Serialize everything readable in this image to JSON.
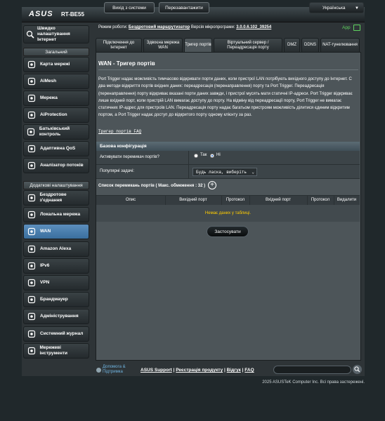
{
  "header": {
    "brand": "ASUS",
    "model": "RT-BE55",
    "logout": "Вихід з системи",
    "reboot": "Перезавантажити",
    "language": "Українська"
  },
  "sidebar": {
    "quick_setup": "Швидко налаштування Інтернет",
    "general_header": "Загальний",
    "general": [
      {
        "label": "Карта мережі",
        "icon": "network-map-icon"
      },
      {
        "label": "AiMesh",
        "icon": "aimesh-icon"
      },
      {
        "label": "Мережа",
        "icon": "network-icon"
      },
      {
        "label": "AiProtection",
        "icon": "shield-icon"
      },
      {
        "label": "Батьківський контроль",
        "icon": "parental-icon"
      },
      {
        "label": "Адаптивна QoS",
        "icon": "qos-gauge-icon"
      },
      {
        "label": "Аналізатор потоків",
        "icon": "traffic-analyzer-icon"
      }
    ],
    "advanced_header": "Додаткові налаштування",
    "advanced": [
      {
        "label": "Бездротове з'єднання",
        "icon": "wireless-icon"
      },
      {
        "label": "Локальна мережа",
        "icon": "lan-icon"
      },
      {
        "label": "WAN",
        "icon": "globe-icon",
        "active": true
      },
      {
        "label": "Amazon Alexa",
        "icon": "alexa-icon"
      },
      {
        "label": "IPv6",
        "icon": "ipv6-icon"
      },
      {
        "label": "VPN",
        "icon": "vpn-icon"
      },
      {
        "label": "Брандмауер",
        "icon": "firewall-icon"
      },
      {
        "label": "Адміністрування",
        "icon": "admin-icon"
      },
      {
        "label": "Системний журнал",
        "icon": "syslog-icon"
      },
      {
        "label": "Мережеві інструменти",
        "icon": "tools-icon"
      }
    ]
  },
  "status": {
    "mode_label": "Режим роботи:",
    "mode_value": "Бездротовий маршрутизатор",
    "fw_label": "Версія мікропрограми:",
    "fw_value": "3.0.0.6.102_39254",
    "app": "App"
  },
  "tabs": [
    "Підключення до Інтернет",
    "Здвоєна мережа WAN",
    "Тригер портів",
    "Віртуальний сервер / Переадресація порту",
    "DMZ",
    "DDNS",
    "NAT-тунелювання"
  ],
  "page": {
    "title": "WAN - Тригер портів",
    "description": "Port Trigger надає можливість тимчасово відкривати порти даних, коли пристрої LAN потрібують вихідного доступу до Інтернет. С два методи відкриття портів вхідних даних: переадресація (перенаправлення) порту та Port Trigger. Переадресація (перенаправлення) порту відкриває вказані порти даних завжди, і пристрої мусять мати статичні IP-адреси. Port Trigger відкриває лише вхідний порт, коли пристрій LAN вимагає доступу до порту. На відміну від переадресації порту, Port Trigger не вимагає статичних IP-адрес для пристроїв LAN. Переадресація порту надає багатьом пристроям можливість ділитися єдиним відкритим портом, а Port Trigger надає доступ до відкритого порту одному клієнту за раз.",
    "faq": "Тригер портів FAQ"
  },
  "config": {
    "header": "Базова конфігурація",
    "enable_label": "Активувати перемикач портів?",
    "yes": "Так",
    "no": "Ні",
    "enabled": false,
    "popular_label": "Популярні задачі:",
    "popular_value": "Будь ласка, виберіть"
  },
  "list": {
    "label": "Список перемикань портів ( Макс. обмеження : 32 )",
    "columns": [
      "Опис",
      "Вихідний порт",
      "Протокол",
      "Вхідний порт",
      "Протокол",
      "Видалити"
    ],
    "empty": "Немає даних у таблиці."
  },
  "apply": "Застосувати",
  "footer": {
    "help": "Допомога & Підтримка",
    "links": [
      "ASUS Support",
      "Реєстрація продукту",
      "Відгук",
      "FAQ"
    ],
    "copyright": "2025 ASUSTeK Computer Inc. Всі права застережені."
  }
}
